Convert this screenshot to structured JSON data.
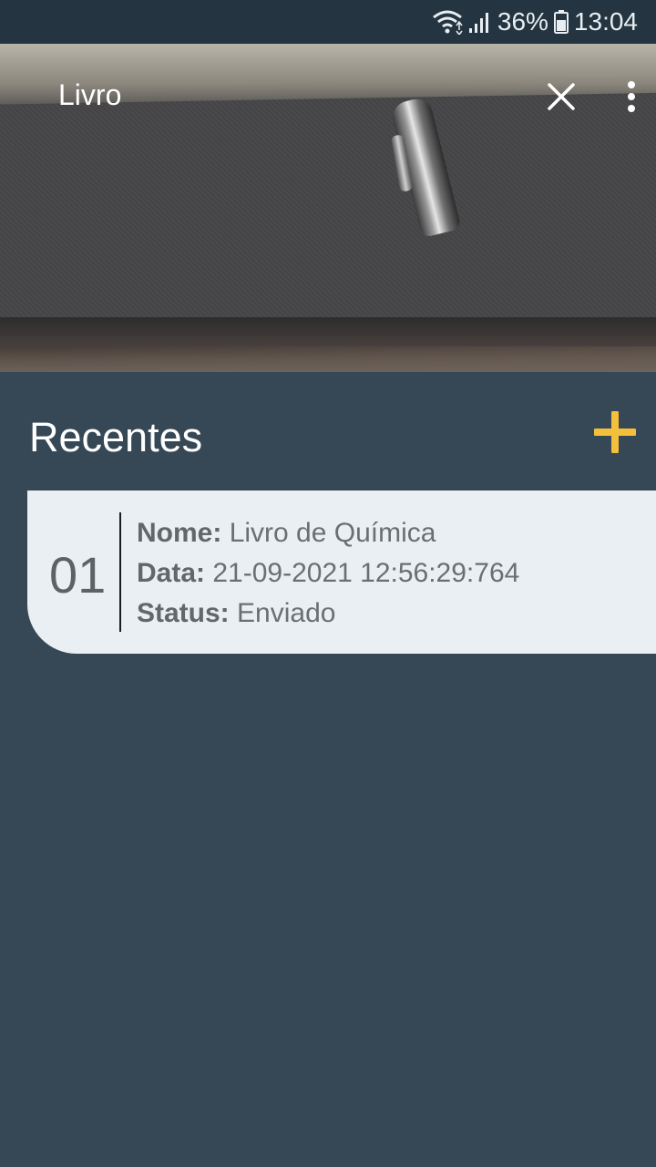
{
  "status_bar": {
    "battery": "36%",
    "time": "13:04",
    "icons": [
      "wifi-icon",
      "signal-icon",
      "battery-icon"
    ]
  },
  "header": {
    "title": "Livro",
    "icons": [
      "close-icon",
      "more-vert-icon"
    ]
  },
  "main": {
    "section_title": "Recentes",
    "add_icon": "plus-icon",
    "accent_color": "#f4c03b",
    "items": [
      {
        "number": "01",
        "name_label": "Nome:",
        "name_value": "Livro de Química",
        "date_label": "Data:",
        "date_value": "21-09-2021 12:56:29:764",
        "status_label": "Status:",
        "status_value": "Enviado"
      }
    ]
  },
  "colors": {
    "background": "#364855",
    "status_bar": "#243440",
    "card": "#e9eff3"
  }
}
